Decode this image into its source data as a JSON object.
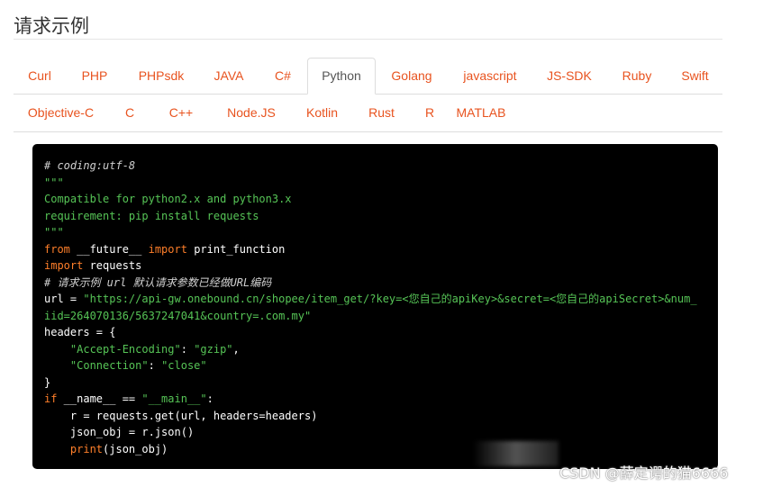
{
  "section": {
    "title": "请求示例"
  },
  "tabs": {
    "row1": [
      "Curl",
      "PHP",
      "PHPsdk",
      "JAVA",
      "C#",
      "Python",
      "Golang",
      "javascript",
      "JS-SDK",
      "Ruby",
      "Swift"
    ],
    "row2": [
      "Objective-C",
      "C",
      "C++",
      "Node.JS",
      "Kotlin",
      "Rust",
      "R",
      "MATLAB"
    ],
    "active": "Python"
  },
  "code": {
    "lines": [
      [
        {
          "t": "# coding:utf-8",
          "c": "comment"
        }
      ],
      [
        {
          "t": "\"\"\"",
          "c": "str"
        }
      ],
      [
        {
          "t": "Compatible for python2.x and python3.x",
          "c": "str"
        }
      ],
      [
        {
          "t": "requirement: pip install requests",
          "c": "str"
        }
      ],
      [
        {
          "t": "\"\"\"",
          "c": "str"
        }
      ],
      [
        {
          "t": "from",
          "c": "kw"
        },
        {
          "t": " __future__ ",
          "c": "plain"
        },
        {
          "t": "import",
          "c": "kw"
        },
        {
          "t": " print_function",
          "c": "plain"
        }
      ],
      [
        {
          "t": "import",
          "c": "kw"
        },
        {
          "t": " requests",
          "c": "plain"
        }
      ],
      [
        {
          "t": "# 请求示例 url 默认请求参数已经做URL编码",
          "c": "comment"
        }
      ],
      [
        {
          "t": "url = ",
          "c": "plain"
        },
        {
          "t": "\"https://api-gw.onebound.cn/shopee/item_get/?key=<您自己的apiKey>&secret=<您自己的apiSecret>&num_",
          "c": "str"
        }
      ],
      [
        {
          "t": "iid=264070136/5637247041&country=.com.my\"",
          "c": "str"
        }
      ],
      [
        {
          "t": "headers = {",
          "c": "plain"
        }
      ],
      [
        {
          "t": "    ",
          "c": "plain"
        },
        {
          "t": "\"Accept-Encoding\"",
          "c": "str"
        },
        {
          "t": ": ",
          "c": "plain"
        },
        {
          "t": "\"gzip\"",
          "c": "str"
        },
        {
          "t": ",",
          "c": "plain"
        }
      ],
      [
        {
          "t": "    ",
          "c": "plain"
        },
        {
          "t": "\"Connection\"",
          "c": "str"
        },
        {
          "t": ": ",
          "c": "plain"
        },
        {
          "t": "\"close\"",
          "c": "str"
        }
      ],
      [
        {
          "t": "}",
          "c": "plain"
        }
      ],
      [
        {
          "t": "if",
          "c": "kw"
        },
        {
          "t": " __name__ == ",
          "c": "plain"
        },
        {
          "t": "\"__main__\"",
          "c": "str"
        },
        {
          "t": ":",
          "c": "plain"
        }
      ],
      [
        {
          "t": "    r = requests.get(url, headers=headers)",
          "c": "plain"
        }
      ],
      [
        {
          "t": "    json_obj = r.json()",
          "c": "plain"
        }
      ],
      [
        {
          "t": "    ",
          "c": "plain"
        },
        {
          "t": "print",
          "c": "kw"
        },
        {
          "t": "(json_obj)",
          "c": "plain"
        }
      ]
    ]
  },
  "watermark": "CSDN @薛定谔的猫6666",
  "colors": {
    "tab_link": "#e8531f",
    "tab_active": "#555555",
    "code_bg": "#000000",
    "code_string": "#56c456",
    "code_keyword": "#ff7f2a",
    "code_comment": "#d0d0d0"
  }
}
